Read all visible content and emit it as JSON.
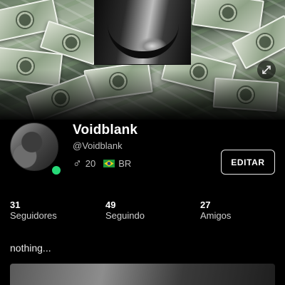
{
  "profile": {
    "display_name": "Voidblank",
    "handle": "@Voidblank",
    "age": "20",
    "gender_icon": "male-symbol-icon",
    "country_code": "BR",
    "country_flag_icon": "brazil-flag-icon",
    "online": true,
    "online_color": "#26d978",
    "bio": "nothing..."
  },
  "actions": {
    "edit_label": "EDITAR"
  },
  "stats": [
    {
      "value": "31",
      "label": "Seguidores"
    },
    {
      "value": "49",
      "label": "Seguindo"
    },
    {
      "value": "27",
      "label": "Amigos"
    }
  ],
  "cover": {
    "background": "money-bills-photo",
    "featured_photo": "black-and-white-photo",
    "expand_icon": "expand-icon"
  }
}
